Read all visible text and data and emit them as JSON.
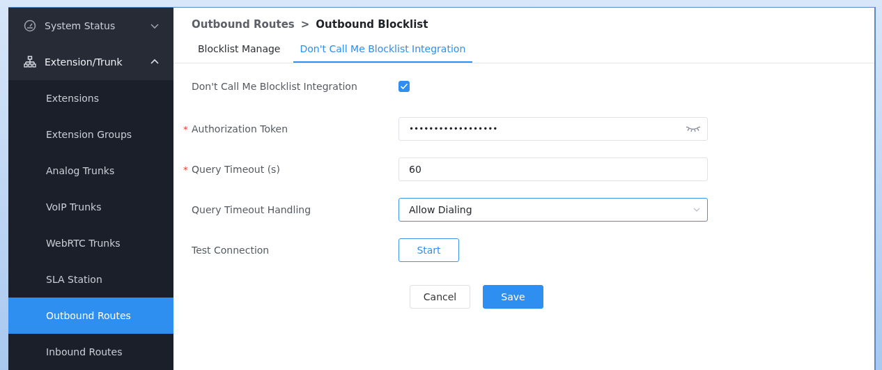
{
  "sidebar": {
    "items": [
      {
        "label": "System Status",
        "expanded": false
      },
      {
        "label": "Extension/Trunk",
        "expanded": true,
        "children": [
          {
            "label": "Extensions",
            "selected": false
          },
          {
            "label": "Extension Groups",
            "selected": false
          },
          {
            "label": "Analog Trunks",
            "selected": false
          },
          {
            "label": "VoIP Trunks",
            "selected": false
          },
          {
            "label": "WebRTC Trunks",
            "selected": false
          },
          {
            "label": "SLA Station",
            "selected": false
          },
          {
            "label": "Outbound Routes",
            "selected": true
          },
          {
            "label": "Inbound Routes",
            "selected": false
          }
        ]
      }
    ]
  },
  "breadcrumb": {
    "parent": "Outbound Routes",
    "separator": ">",
    "current": "Outbound Blocklist"
  },
  "tabs": [
    {
      "label": "Blocklist Manage",
      "selected": false
    },
    {
      "label": "Don't Call Me Blocklist Integration",
      "selected": true
    }
  ],
  "form": [
    {
      "kind": "checkbox",
      "label": "Don't Call Me Blocklist Integration",
      "checked": true
    },
    {
      "kind": "password",
      "label": "Authorization Token",
      "required_mark": "*",
      "value": "••••••••••••••••••"
    },
    {
      "kind": "text",
      "label": "Query Timeout (s)",
      "required_mark": "*",
      "value": "60"
    },
    {
      "kind": "select",
      "label": "Query Timeout Handling",
      "value": "Allow Dialing",
      "focused": true
    },
    {
      "kind": "button",
      "label": "Test Connection",
      "button": "Start"
    }
  ],
  "actions": [
    {
      "label": "Cancel",
      "kind": "default"
    },
    {
      "label": "Save",
      "kind": "primary"
    }
  ]
}
